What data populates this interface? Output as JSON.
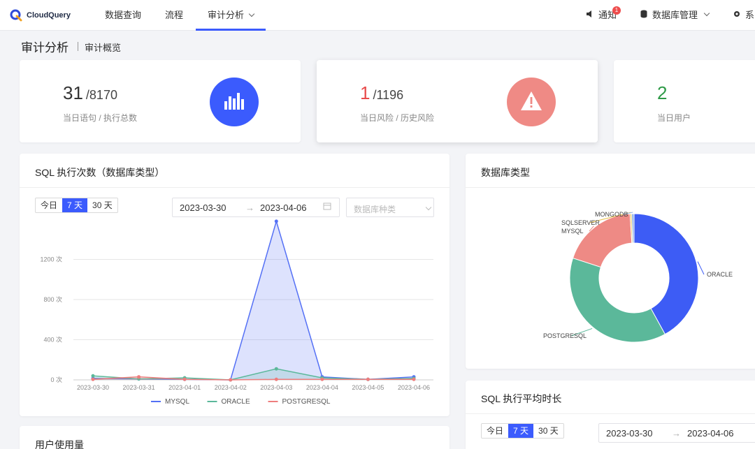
{
  "app": {
    "name": "CloudQuery"
  },
  "nav": {
    "items": [
      "数据查询",
      "流程",
      "审计分析"
    ],
    "notify_label": "通知",
    "notify_count": "1",
    "db_manage_label": "数据库管理",
    "settings_label": "系"
  },
  "page": {
    "title": "审计分析",
    "subtitle": "审计概览"
  },
  "stats": [
    {
      "value": "31",
      "total": "/8170",
      "label": "当日语句 / 执行总数",
      "color": "#333333",
      "icon": "bar-chart-icon",
      "circle": "#3b5bfd"
    },
    {
      "value": "1",
      "total": "/1196",
      "label": "当日风险 / 历史风险",
      "color": "#e84a4a",
      "icon": "warning-icon",
      "circle": "#ef8a85"
    },
    {
      "value": "2",
      "total": "",
      "label": "当日用户",
      "color": "#2e9a47"
    }
  ],
  "sql_exec": {
    "title": "SQL 执行次数（数据库类型）",
    "tabs": [
      "今日",
      "7 天",
      "30 天"
    ],
    "selected_tab": "7 天",
    "date_start": "2023-03-30",
    "date_end": "2023-04-06",
    "db_select_placeholder": "数据库种类"
  },
  "db_type": {
    "title": "数据库类型"
  },
  "sql_avg": {
    "title": "SQL 执行平均时长",
    "tabs": [
      "今日",
      "7 天",
      "30 天"
    ],
    "selected_tab": "7 天",
    "date_start": "2023-03-30",
    "date_end": "2023-04-06"
  },
  "user_usage": {
    "title": "用户使用量"
  },
  "chart_data": [
    {
      "type": "area",
      "categories": [
        "2023-03-30",
        "2023-03-31",
        "2023-04-01",
        "2023-04-02",
        "2023-04-03",
        "2023-04-04",
        "2023-04-05",
        "2023-04-06"
      ],
      "yticks": [
        "0 次",
        "400 次",
        "800 次",
        "1200 次"
      ],
      "ylim": [
        0,
        1600
      ],
      "series": [
        {
          "name": "MYSQL",
          "color": "#5470f5",
          "values": [
            15,
            10,
            5,
            0,
            1580,
            30,
            5,
            30
          ]
        },
        {
          "name": "ORACLE",
          "color": "#5bb89a",
          "values": [
            40,
            10,
            20,
            0,
            110,
            20,
            5,
            15
          ]
        },
        {
          "name": "POSTGRESQL",
          "color": "#ee7d7d",
          "values": [
            5,
            30,
            5,
            0,
            5,
            5,
            5,
            5
          ]
        }
      ],
      "legend": "bottom"
    },
    {
      "type": "pie",
      "slices": [
        {
          "label": "ORACLE",
          "value": 42,
          "color": "#3d5cf5"
        },
        {
          "label": "POSTGRESQL",
          "value": 38,
          "color": "#5bb89a"
        },
        {
          "label": "MYSQL",
          "value": 19,
          "color": "#ee8a85"
        },
        {
          "label": "SQLSERVER",
          "value": 0.4,
          "color": "#e8c14a"
        },
        {
          "label": "MONGODB",
          "value": 0.6,
          "color": "#8fb3e8"
        }
      ]
    }
  ]
}
